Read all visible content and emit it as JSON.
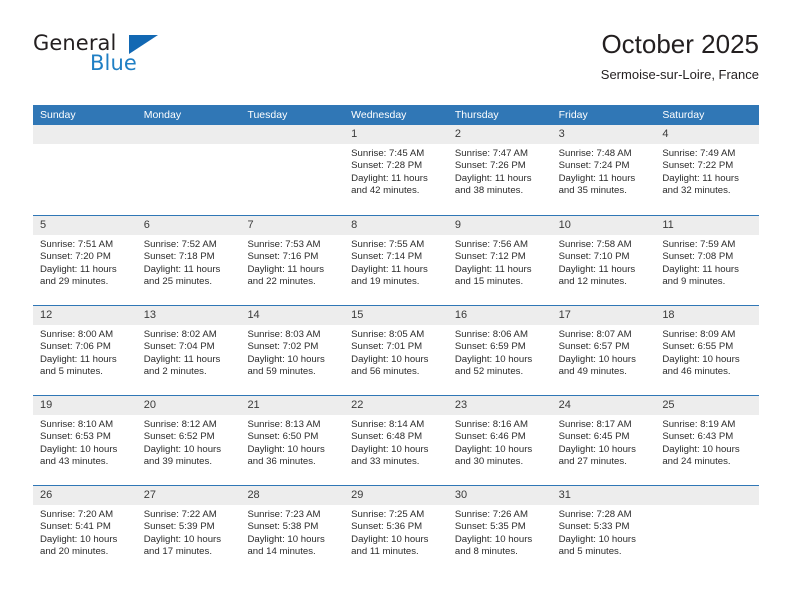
{
  "brand": {
    "name_part1": "General",
    "name_part2": "Blue",
    "triangle_color": "#1268b3",
    "blue_color": "#1f7fc4"
  },
  "header": {
    "title": "October 2025",
    "subtitle": "Sermoise-sur-Loire, France"
  },
  "theme": {
    "header_blue": "#3077b6",
    "daynum_band": "#ededed",
    "separator": "#3077b6"
  },
  "weekdays": [
    "Sunday",
    "Monday",
    "Tuesday",
    "Wednesday",
    "Thursday",
    "Friday",
    "Saturday"
  ],
  "labels": {
    "sunrise": "Sunrise:",
    "sunset": "Sunset:",
    "daylight": "Daylight:"
  },
  "weeks": [
    [
      {
        "day": "",
        "empty": true
      },
      {
        "day": "",
        "empty": true
      },
      {
        "day": "",
        "empty": true
      },
      {
        "day": "1",
        "sunrise": "Sunrise: 7:45 AM",
        "sunset": "Sunset: 7:28 PM",
        "daylight1": "Daylight: 11 hours",
        "daylight2": "and 42 minutes."
      },
      {
        "day": "2",
        "sunrise": "Sunrise: 7:47 AM",
        "sunset": "Sunset: 7:26 PM",
        "daylight1": "Daylight: 11 hours",
        "daylight2": "and 38 minutes."
      },
      {
        "day": "3",
        "sunrise": "Sunrise: 7:48 AM",
        "sunset": "Sunset: 7:24 PM",
        "daylight1": "Daylight: 11 hours",
        "daylight2": "and 35 minutes."
      },
      {
        "day": "4",
        "sunrise": "Sunrise: 7:49 AM",
        "sunset": "Sunset: 7:22 PM",
        "daylight1": "Daylight: 11 hours",
        "daylight2": "and 32 minutes."
      }
    ],
    [
      {
        "day": "5",
        "sunrise": "Sunrise: 7:51 AM",
        "sunset": "Sunset: 7:20 PM",
        "daylight1": "Daylight: 11 hours",
        "daylight2": "and 29 minutes."
      },
      {
        "day": "6",
        "sunrise": "Sunrise: 7:52 AM",
        "sunset": "Sunset: 7:18 PM",
        "daylight1": "Daylight: 11 hours",
        "daylight2": "and 25 minutes."
      },
      {
        "day": "7",
        "sunrise": "Sunrise: 7:53 AM",
        "sunset": "Sunset: 7:16 PM",
        "daylight1": "Daylight: 11 hours",
        "daylight2": "and 22 minutes."
      },
      {
        "day": "8",
        "sunrise": "Sunrise: 7:55 AM",
        "sunset": "Sunset: 7:14 PM",
        "daylight1": "Daylight: 11 hours",
        "daylight2": "and 19 minutes."
      },
      {
        "day": "9",
        "sunrise": "Sunrise: 7:56 AM",
        "sunset": "Sunset: 7:12 PM",
        "daylight1": "Daylight: 11 hours",
        "daylight2": "and 15 minutes."
      },
      {
        "day": "10",
        "sunrise": "Sunrise: 7:58 AM",
        "sunset": "Sunset: 7:10 PM",
        "daylight1": "Daylight: 11 hours",
        "daylight2": "and 12 minutes."
      },
      {
        "day": "11",
        "sunrise": "Sunrise: 7:59 AM",
        "sunset": "Sunset: 7:08 PM",
        "daylight1": "Daylight: 11 hours",
        "daylight2": "and 9 minutes."
      }
    ],
    [
      {
        "day": "12",
        "sunrise": "Sunrise: 8:00 AM",
        "sunset": "Sunset: 7:06 PM",
        "daylight1": "Daylight: 11 hours",
        "daylight2": "and 5 minutes."
      },
      {
        "day": "13",
        "sunrise": "Sunrise: 8:02 AM",
        "sunset": "Sunset: 7:04 PM",
        "daylight1": "Daylight: 11 hours",
        "daylight2": "and 2 minutes."
      },
      {
        "day": "14",
        "sunrise": "Sunrise: 8:03 AM",
        "sunset": "Sunset: 7:02 PM",
        "daylight1": "Daylight: 10 hours",
        "daylight2": "and 59 minutes."
      },
      {
        "day": "15",
        "sunrise": "Sunrise: 8:05 AM",
        "sunset": "Sunset: 7:01 PM",
        "daylight1": "Daylight: 10 hours",
        "daylight2": "and 56 minutes."
      },
      {
        "day": "16",
        "sunrise": "Sunrise: 8:06 AM",
        "sunset": "Sunset: 6:59 PM",
        "daylight1": "Daylight: 10 hours",
        "daylight2": "and 52 minutes."
      },
      {
        "day": "17",
        "sunrise": "Sunrise: 8:07 AM",
        "sunset": "Sunset: 6:57 PM",
        "daylight1": "Daylight: 10 hours",
        "daylight2": "and 49 minutes."
      },
      {
        "day": "18",
        "sunrise": "Sunrise: 8:09 AM",
        "sunset": "Sunset: 6:55 PM",
        "daylight1": "Daylight: 10 hours",
        "daylight2": "and 46 minutes."
      }
    ],
    [
      {
        "day": "19",
        "sunrise": "Sunrise: 8:10 AM",
        "sunset": "Sunset: 6:53 PM",
        "daylight1": "Daylight: 10 hours",
        "daylight2": "and 43 minutes."
      },
      {
        "day": "20",
        "sunrise": "Sunrise: 8:12 AM",
        "sunset": "Sunset: 6:52 PM",
        "daylight1": "Daylight: 10 hours",
        "daylight2": "and 39 minutes."
      },
      {
        "day": "21",
        "sunrise": "Sunrise: 8:13 AM",
        "sunset": "Sunset: 6:50 PM",
        "daylight1": "Daylight: 10 hours",
        "daylight2": "and 36 minutes."
      },
      {
        "day": "22",
        "sunrise": "Sunrise: 8:14 AM",
        "sunset": "Sunset: 6:48 PM",
        "daylight1": "Daylight: 10 hours",
        "daylight2": "and 33 minutes."
      },
      {
        "day": "23",
        "sunrise": "Sunrise: 8:16 AM",
        "sunset": "Sunset: 6:46 PM",
        "daylight1": "Daylight: 10 hours",
        "daylight2": "and 30 minutes."
      },
      {
        "day": "24",
        "sunrise": "Sunrise: 8:17 AM",
        "sunset": "Sunset: 6:45 PM",
        "daylight1": "Daylight: 10 hours",
        "daylight2": "and 27 minutes."
      },
      {
        "day": "25",
        "sunrise": "Sunrise: 8:19 AM",
        "sunset": "Sunset: 6:43 PM",
        "daylight1": "Daylight: 10 hours",
        "daylight2": "and 24 minutes."
      }
    ],
    [
      {
        "day": "26",
        "sunrise": "Sunrise: 7:20 AM",
        "sunset": "Sunset: 5:41 PM",
        "daylight1": "Daylight: 10 hours",
        "daylight2": "and 20 minutes."
      },
      {
        "day": "27",
        "sunrise": "Sunrise: 7:22 AM",
        "sunset": "Sunset: 5:39 PM",
        "daylight1": "Daylight: 10 hours",
        "daylight2": "and 17 minutes."
      },
      {
        "day": "28",
        "sunrise": "Sunrise: 7:23 AM",
        "sunset": "Sunset: 5:38 PM",
        "daylight1": "Daylight: 10 hours",
        "daylight2": "and 14 minutes."
      },
      {
        "day": "29",
        "sunrise": "Sunrise: 7:25 AM",
        "sunset": "Sunset: 5:36 PM",
        "daylight1": "Daylight: 10 hours",
        "daylight2": "and 11 minutes."
      },
      {
        "day": "30",
        "sunrise": "Sunrise: 7:26 AM",
        "sunset": "Sunset: 5:35 PM",
        "daylight1": "Daylight: 10 hours",
        "daylight2": "and 8 minutes."
      },
      {
        "day": "31",
        "sunrise": "Sunrise: 7:28 AM",
        "sunset": "Sunset: 5:33 PM",
        "daylight1": "Daylight: 10 hours",
        "daylight2": "and 5 minutes."
      },
      {
        "day": "",
        "empty": true
      }
    ]
  ]
}
